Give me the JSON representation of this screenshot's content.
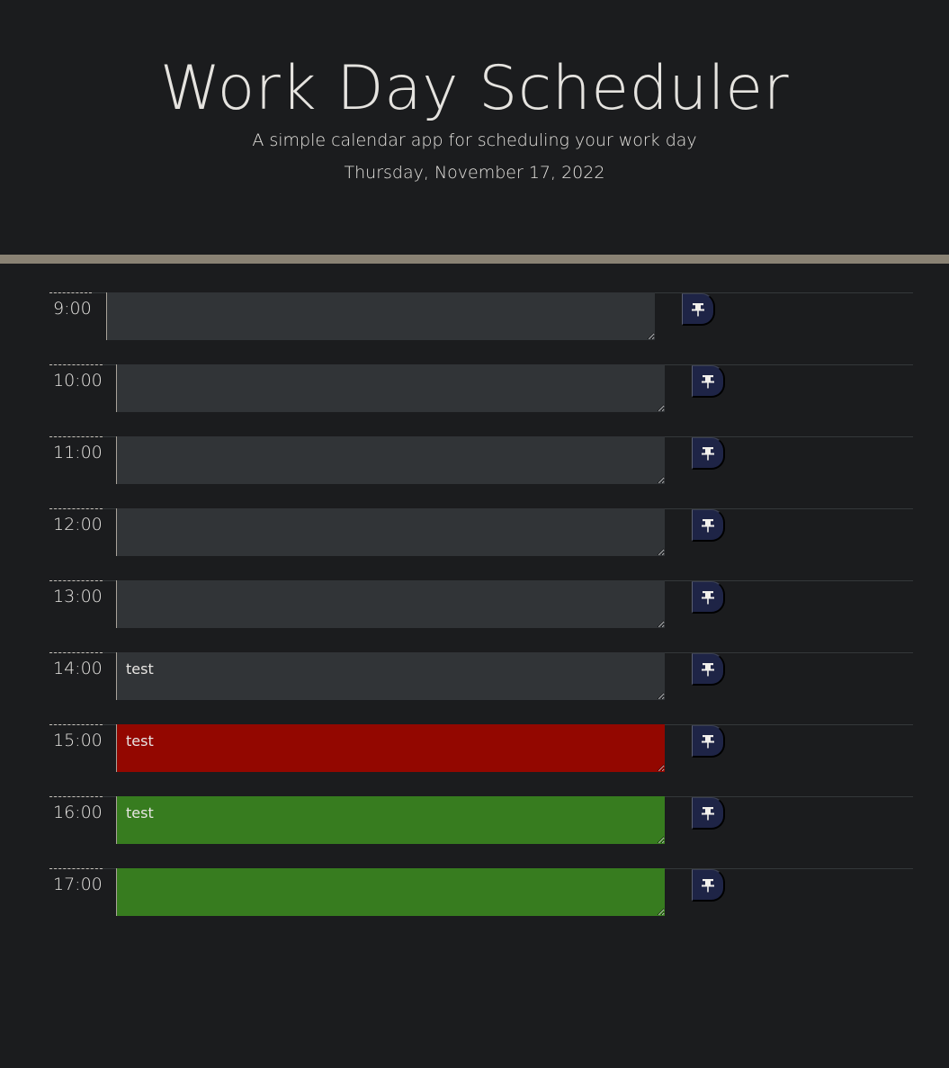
{
  "header": {
    "title": "Work Day Scheduler",
    "subtitle": "A simple calendar app for scheduling your work day",
    "current_day": "Thursday, November 17, 2022"
  },
  "colors": {
    "past": "#313437",
    "present": "#930700",
    "future": "#377c1f",
    "divider": "#8a8274",
    "save_button": "#1e2446"
  },
  "save_icon": "pushpin-icon",
  "time_blocks": [
    {
      "hour": "9:00",
      "text": "",
      "state": "past"
    },
    {
      "hour": "10:00",
      "text": "",
      "state": "past"
    },
    {
      "hour": "11:00",
      "text": "",
      "state": "past"
    },
    {
      "hour": "12:00",
      "text": "",
      "state": "past"
    },
    {
      "hour": "13:00",
      "text": "",
      "state": "past"
    },
    {
      "hour": "14:00",
      "text": "test",
      "state": "past"
    },
    {
      "hour": "15:00",
      "text": "test",
      "state": "present"
    },
    {
      "hour": "16:00",
      "text": "test",
      "state": "future"
    },
    {
      "hour": "17:00",
      "text": "",
      "state": "future"
    }
  ]
}
